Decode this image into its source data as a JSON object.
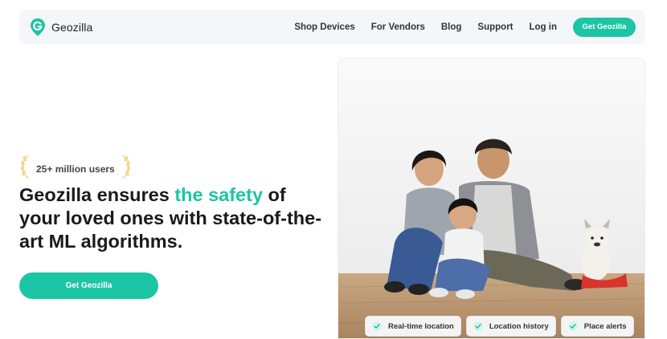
{
  "brand": {
    "name": "Geozilla",
    "accent_color": "#1cc5a4"
  },
  "nav": {
    "links": [
      "Shop Devices",
      "For Vendors",
      "Blog",
      "Support",
      "Log in"
    ],
    "cta_label": "Get Geozilla"
  },
  "hero": {
    "badge": "25+ million users",
    "headline_before": "Geozilla ensures ",
    "headline_accent": "the safety",
    "headline_after": " of your loved ones with state-of-the-art ML algorithms.",
    "cta_label": "Get Geozilla"
  },
  "photo": {
    "alt": "family-photo",
    "features": [
      "Real-time location",
      "Location history",
      "Place alerts"
    ]
  },
  "icons": {
    "logo": "location-pin-g-icon",
    "badge": "laurel-wreath-icon",
    "feature": "check-icon"
  }
}
